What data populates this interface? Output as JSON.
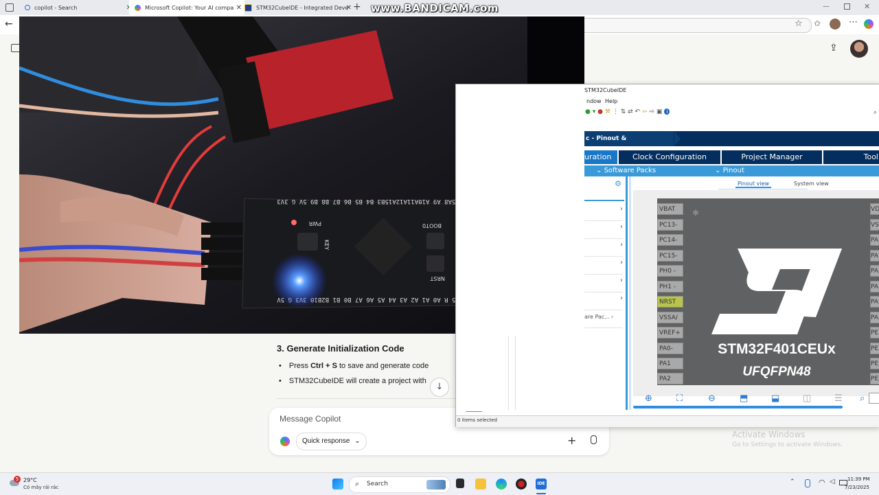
{
  "watermark": "www.BANDICAM.com",
  "tabs": [
    {
      "title": "copilot - Search",
      "color": "#2b6cd1"
    },
    {
      "title": "Microsoft Copilot: Your AI compa",
      "color": "#7a5af8"
    },
    {
      "title": "STM32CubeIDE - Integrated Deve",
      "color": "#1d3d8f"
    }
  ],
  "copilot": {
    "step_heading": "3. Generate Initialization Code",
    "bullet1_pre": "Press ",
    "bullet1_bold": "Ctrl + S",
    "bullet1_post": " to save and generate code",
    "bullet2": "STM32CubeIDE will create a project with",
    "message_placeholder": "Message Copilot",
    "quick_response": "Quick response"
  },
  "ide": {
    "title": "STM32CubeIDE",
    "menu": [
      "ndow",
      "Help"
    ],
    "breadcrumb": "c - Pinout & Configuration",
    "tabs": [
      "uration",
      "Clock Configuration",
      "Project Manager",
      "Tool"
    ],
    "subtabs": [
      "Software Packs",
      "Pinout"
    ],
    "views": [
      "Pinout view",
      "System view"
    ],
    "left_list_last": "are Pac...",
    "pins_left": [
      "VBAT",
      "PC13-",
      "PC14-",
      "PC15-",
      "PH0 -",
      "PH1 -",
      "NRST",
      "VSSA/",
      "VREF+",
      "PA0-",
      "PA1",
      "PA2"
    ],
    "pins_right": [
      "VD",
      "VS",
      "PA",
      "PA",
      "PA",
      "PA",
      "PA",
      "PA",
      "PE",
      "PE",
      "PE",
      "PE"
    ],
    "chip_name": "STM32F401CEUx",
    "chip_package": "UFQFPN48",
    "status": "0 items selected"
  },
  "activate": {
    "line1": "Activate Windows",
    "line2": "Go to Settings to activate Windows."
  },
  "taskbar": {
    "weather_temp": "29°C",
    "weather_desc": "Có mây rải rác",
    "badge": "5",
    "search": "Search",
    "time": "11:39 PM",
    "date": "7/23/2025"
  },
  "board_silkscreen": {
    "top_row": "B12B13B14B15A8 A9 A10A11A12A15B3 B4 B5 B6 B7 B8 B9 5V G 3V3",
    "bottom_row": "VB C13C14C15 R A0 A1 A2 A3 A4 A5 A6 A7 B0 B1 B2B10 3V3 G 5V",
    "pwr": "PWR",
    "key": "KEY",
    "boot": "BOOT0",
    "nrst": "NRST"
  }
}
